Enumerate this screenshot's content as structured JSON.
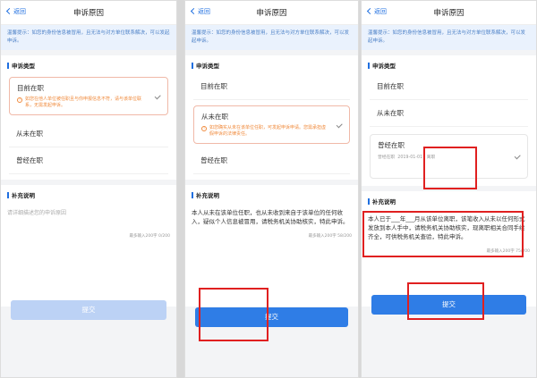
{
  "nav": {
    "back": "返回",
    "title": "申诉原因"
  },
  "tip": "温馨提示：如您的身份信息被冒用，且无法与对方单位联系解决，可以发起申诉。",
  "section_type": "申诉类型",
  "section_supp": "补充说明",
  "options": {
    "current": "目前在职",
    "never": "从未在职",
    "former": "曾经在职"
  },
  "warn_p1": "如您在他人单位被任职且与你申报信息不符，请与该单位联系，无需发起申诉。",
  "warn_p2": "如您确实从未在该单位任职，可发起申诉申请。您需承担虚假申诉的法律责任。",
  "former_hint": "曾经在职",
  "former_dates": "2019-01-01",
  "former_mid": "离职",
  "placeholder": "请详细描述您的申诉原因",
  "counter_1": "最多输入200字 0/200",
  "counter_2": "最多输入200字 58/200",
  "counter_3": "最多输入200字 75/200",
  "supp_text_2": "本人从未在该单位任职，也从未收到来自于该单位的任何收入，疑似个人信息被冒用，请税务机关协助核实，特此申诉。",
  "supp_text_3": "本人已于___年___月从该单位离职，该笔收入从未以任何形式发放到本人手中，请税务机关协助核实，现离职相关合同手续齐全，可供税务机关查验，特此申诉。",
  "submit": "提交",
  "colors": {
    "accent": "#2f7de6",
    "warning": "#f08a3c",
    "highlight": "#e02020"
  }
}
